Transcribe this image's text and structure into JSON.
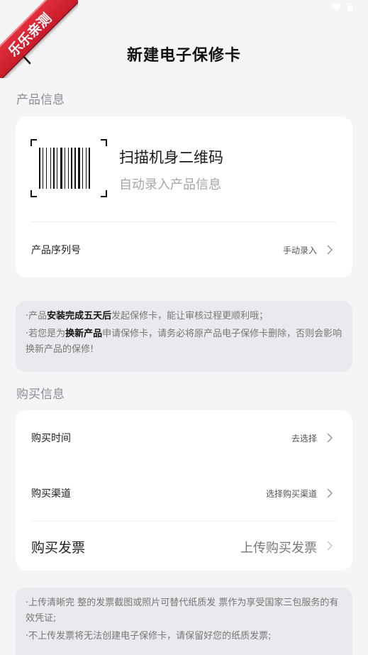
{
  "ribbon": {
    "text": "乐乐亲测"
  },
  "header": {
    "title": "新建电子保修卡"
  },
  "product_section": {
    "label": "产品信息",
    "scan_title": "扫描机身二维码",
    "scan_subtitle": "自动录入产品信息",
    "serial_label": "产品序列号",
    "serial_action": "手动录入"
  },
  "notice1": {
    "line1_pre": "产品",
    "line1_bold": "安装完成五天后",
    "line1_post": "发起保修卡，能让审核过程更顺利哦；",
    "line2_pre": "若您是为",
    "line2_bold": "换新产品",
    "line2_post": "申请保修卡，请务必将原产品电子保修卡删除，否则会影响换新产品的保修!"
  },
  "purchase_section": {
    "label": "购买信息",
    "time_label": "购买时间",
    "time_action": "去选择",
    "channel_label": "购买渠道",
    "channel_action": "选择购买渠道",
    "invoice_label": "购买发票",
    "invoice_action": "上传购买发票"
  },
  "notice2": {
    "line1": "上传清晰完 整的发票截图或照片可替代纸质发 票作为享受国家三包服务的有效凭证;",
    "line2": "不上传发票将无法创建电子保修卡，请保留好您的纸质发票;"
  },
  "colors": {
    "background": "#f4f5f7",
    "card": "#ffffff",
    "notice": "#e9eaee",
    "ribbon": "#d42430"
  },
  "icons": [
    "back-arrow-icon",
    "barcode-icon",
    "chevron-right-icon",
    "wifi-icon",
    "battery-icon"
  ]
}
